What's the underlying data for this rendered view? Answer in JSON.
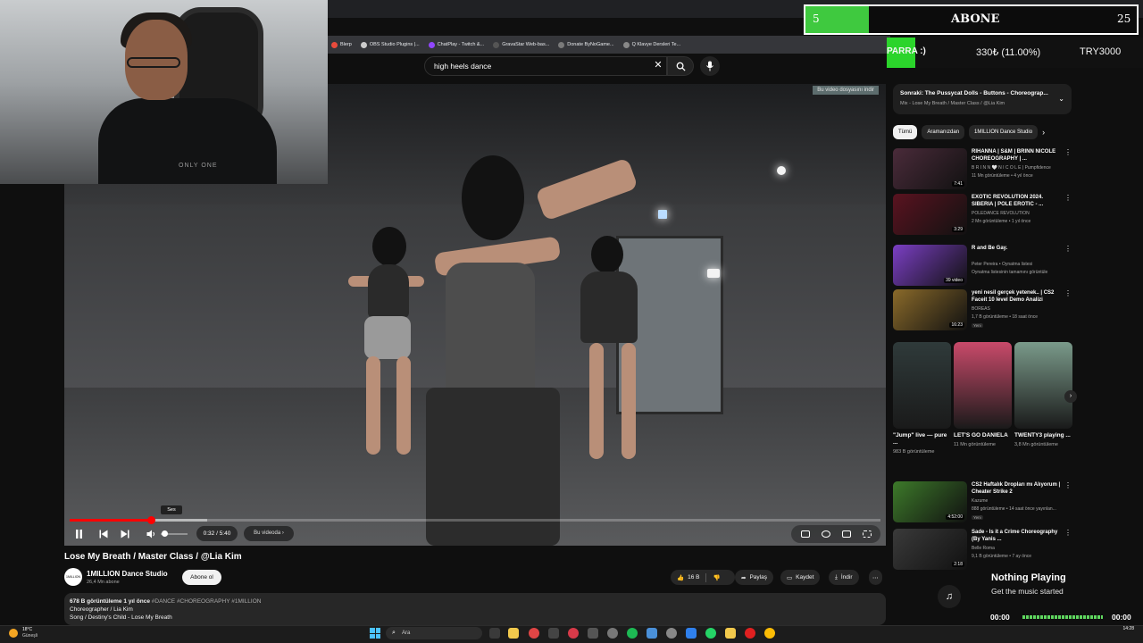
{
  "browser": {
    "bookmarks": [
      "Blerp",
      "OBS Studio Plugins |...",
      "ChatPlay - Twitch &...",
      "GravaStar Web-bas...",
      "Donate ByNoGame...",
      "Q Klavye Dersleri Te..."
    ]
  },
  "webcam": {
    "shirt_text": "ONLY ONE"
  },
  "search": {
    "query": "high heels dance"
  },
  "video": {
    "overlay_caption": "Bu video dosyasını indir",
    "volume_tooltip": "Ses",
    "current_time": "0:32 / 5:40",
    "chapter_label": "Bu videoda  ›",
    "progress_fraction": 0.1,
    "buffer_fraction": 0.17,
    "title": "Lose My Breath / Master Class / @Lia Kim"
  },
  "channel": {
    "avatar_text": "1MILLION",
    "name": "1MILLION Dance Studio",
    "subs": "26,4 Mn abone",
    "subscribe_label": "Abone ol"
  },
  "actions": {
    "likes": "16 B",
    "share": "Paylaş",
    "save": "Kaydet",
    "download": "İndir",
    "more": "⋯"
  },
  "description": {
    "stats": "678 B görüntüleme  1 yıl önce",
    "tags": "#DANCE #CHOREOGRAPHY #1MILLION",
    "line2": "Choreographer / Lia Kim",
    "line3": "Song / Destiny's Child - Lose My Breath"
  },
  "sidebar": {
    "next_title": "Sonraki: The Pussycat Dolls - Buttons - Choreograp...",
    "next_sub": "Mix - Lose My Breath / Master Class / @Lia Kim",
    "chips": [
      "Tümü",
      "Aramanızdan",
      "1MILLION Dance Studio"
    ],
    "recs": [
      {
        "title": "RIHANNA | S&M | BRINN NICOLE CHOREOGRAPHY | ...",
        "channel": "B R I N N 🤍 N I C O L E | Pumpfidence",
        "meta": "11 Mn görüntüleme • 4 yıl önce",
        "dur": "7:41",
        "badge": "",
        "color": "#4a2b3a"
      },
      {
        "title": "EXOTIC REVOLUTION 2024. SIBERIA | POLE EROTIC - ...",
        "channel": "POLEDANCE REVOLUTION",
        "meta": "2 Mn görüntüleme • 1 yıl önce",
        "dur": "3:29",
        "badge": "",
        "color": "#5a1320"
      },
      {
        "title": "R and Be Gay.",
        "channel": "Peter Pereira • Oynatma listesi",
        "meta": "Oynatma listesinin tamamını görüntüle",
        "dur": "39 video",
        "badge": "",
        "color": "#7b3fc4"
      },
      {
        "title": "yeni nesil gerçek yetenek.. | CS2 Faceit 10 level Demo Analizi",
        "channel": "BOREAS",
        "meta": "1,7 B görüntüleme • 18 saat önce",
        "dur": "16:23",
        "badge": "Yeni",
        "color": "#8a6a2a"
      },
      {
        "title": "CS2 Haftalık Dropları mı Alıyorum | Cheater Strike 2",
        "channel": "Kazume",
        "meta": "888 görüntüleme • 14 saat önce yayınlan...",
        "dur": "4:52:00",
        "badge": "Yeni",
        "color": "#3d7a2a"
      },
      {
        "title": "Sade - Is it a Crime Choreography (By Yanis ...",
        "channel": "Belle Roma",
        "meta": "9,1 B görüntüleme • 7 ay önce",
        "dur": "2:18",
        "badge": "",
        "color": "#3a3a3a"
      }
    ],
    "shorts": [
      {
        "title": "\"Jump\" live — pure ...",
        "views": "983 B görüntüleme",
        "color": "#2f3a3a"
      },
      {
        "title": "LET'S GO DANIELA",
        "views": "11 Mn görüntüleme",
        "color": "#c94a6a"
      },
      {
        "title": "TWENTY3 playing ...",
        "views": "3,8 Mn görüntüleme",
        "color": "#7a9a8a"
      }
    ]
  },
  "overlay": {
    "abone_count": "5",
    "abone_label": "ABONE",
    "abone_goal": "25",
    "donate_label": "PARRA :)",
    "donate_amount": "330₺ (11.00%)",
    "donate_goal": "TRY3000",
    "now_playing_title": "Nothing Playing",
    "now_playing_sub": "Get the music started",
    "np_start": "00:00",
    "np_end": "00:00"
  },
  "taskbar": {
    "weather_temp": "18°C",
    "weather_desc": "Güneşli",
    "search_placeholder": "Ara",
    "time": "14:28"
  },
  "colors": {
    "accent": "#ff0000",
    "overlay_green": "#3fc93f"
  }
}
